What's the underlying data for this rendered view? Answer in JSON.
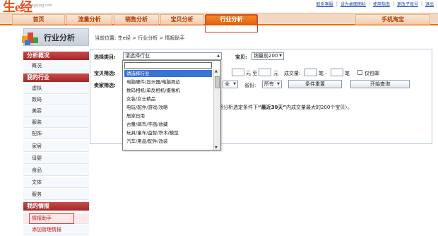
{
  "brand": {
    "logo": "生e经",
    "domain": "zhengejing.com"
  },
  "top_links": [
    "联系客服",
    "设为桌面图标",
    "使用指南",
    "更改子账号",
    "退出"
  ],
  "nav": {
    "items": [
      "首页",
      "流量分析",
      "销售分析",
      "宝贝分析",
      "行业分析",
      "手机淘宝"
    ],
    "active_index": 4
  },
  "sidebar": {
    "title": "行业分析",
    "groups": [
      {
        "label": "分析概况",
        "items": [
          "概况"
        ]
      },
      {
        "label": "我的行业",
        "items": [
          "虚拟",
          "数码",
          "美容",
          "服装",
          "配饰",
          "家居",
          "母婴",
          "食品",
          "文体",
          "服务"
        ]
      },
      {
        "label": "我的情报",
        "items": [
          "情报助手",
          "添加管理情报"
        ]
      }
    ],
    "selected": "情报助手"
  },
  "breadcrumb": "当前位置: 生e经 > 行业分析 > 情报助手",
  "form": {
    "category_label": "选择类目:",
    "category_value": "请选择行业",
    "baobei_label": "宝贝:",
    "baobei_value": "销量前200",
    "item_filter_label": "宝贝筛选:",
    "price_from_suffix": "元 至",
    "price_to_suffix": "元",
    "volume_label": "成交量:",
    "volume_unit_1": "笔 -",
    "volume_unit_2": "笔",
    "only_mall_label": "仅包邮",
    "seller_filter_label": "卖家筛选:",
    "seller_select": "全",
    "province_label": "省份:",
    "province_value": "所有",
    "reset_button": "条件重置",
    "query_button": "开始查询"
  },
  "dropdown": {
    "options": [
      "请选择行业",
      "电脑硬件/显示器/电脑周边",
      "数码相机/单反相机/摄像机",
      "女装/女士精品",
      "电玩/配件/游戏/攻略",
      "居家日用",
      "古董/邮币/字画/收藏",
      "玩具/童车/益智/积木/模型",
      "汽车/用品/配件/改装"
    ],
    "highlighted_index": 0
  },
  "result_note": {
    "prefix": "（这里将分析选定条件下",
    "strong": "“最近30天”",
    "suffix": "内成交量最大的200个宝贝）。"
  },
  "colors": {
    "accent": "#e86d17",
    "sidebar_group": "#b52f2f",
    "link": "#1a47b8",
    "highlight": "#3874d6"
  }
}
